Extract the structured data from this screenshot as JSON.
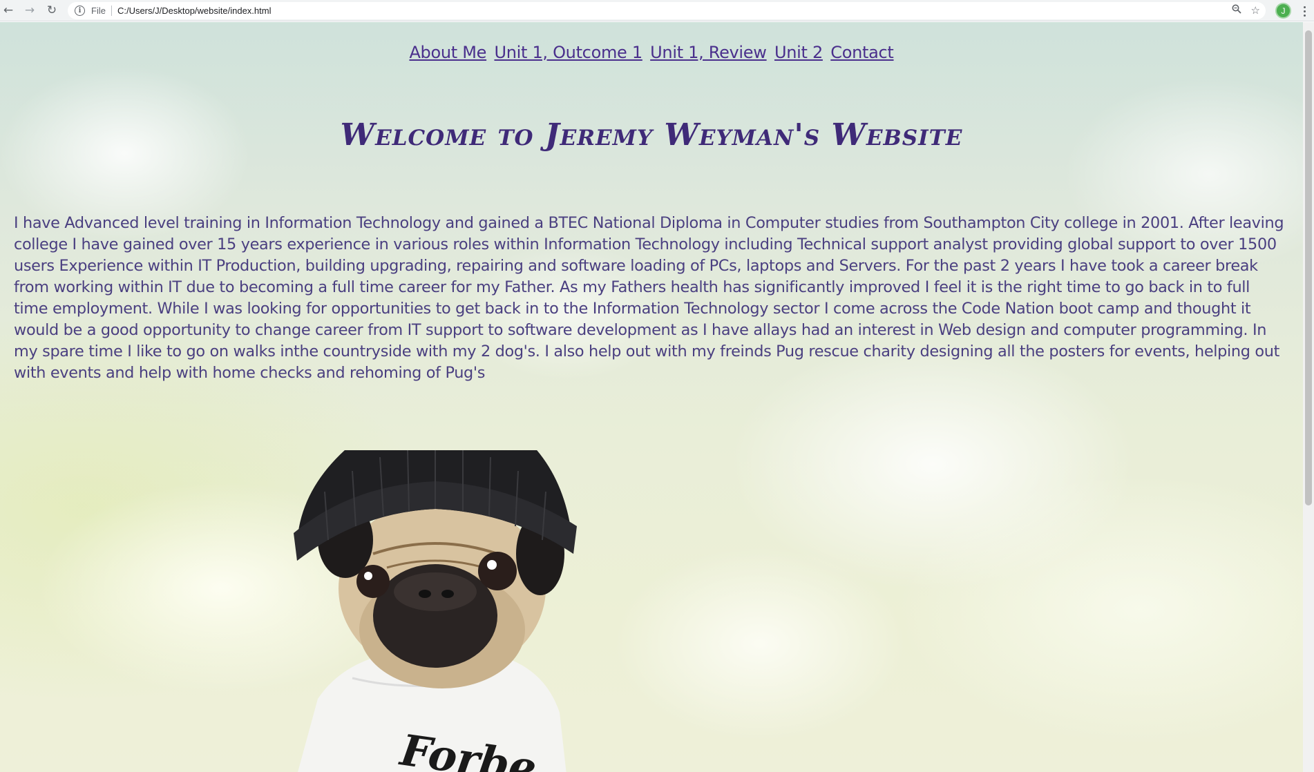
{
  "browser": {
    "scheme_label": "File",
    "url": "C:/Users/J/Desktop/website/index.html",
    "profile_initial": "J",
    "icons": {
      "back": "arrow-left-icon",
      "forward": "arrow-right-icon",
      "reload": "reload-icon",
      "info": "info-icon",
      "zoom": "magnifier-icon",
      "bookmark": "star-icon",
      "menu": "three-dots-icon"
    }
  },
  "nav": {
    "items": [
      {
        "label": "About Me"
      },
      {
        "label": "Unit 1, Outcome 1"
      },
      {
        "label": "Unit 1, Review"
      },
      {
        "label": "Unit 2"
      },
      {
        "label": "Contact"
      }
    ]
  },
  "page": {
    "title": "Welcome to Jeremy Weyman's Website",
    "bio": "I have Advanced level training in Information Technology and gained a BTEC National Diploma in Computer studies from Southampton City college in 2001. After leaving college I have gained over 15 years experience in various roles within Information Technology including Technical support analyst providing global support to over 1500 users Experience within IT Production, building upgrading, repairing and software loading of PCs, laptops and Servers. For the past 2 years I have took a career break from working within IT due to becoming a full time career for my Father. As my Fathers health has significantly improved I feel it is the right time to go back in to full time employment. While I was looking for opportunities to get back in to the Information Technology sector I come across the Code Nation boot camp and thought it would be a good opportunity to change career from IT support to software development as I have allays had an interest in Web design and computer programming. In my spare time I like to go on walks inthe countryside with my 2 dog's. I also help out with my freinds Pug rescue charity designing all the posters for events, helping out with events and help with home checks and rehoming of Pug's",
    "image_shirt_text": "Forbe"
  },
  "colors": {
    "link": "#4a2f8c",
    "title": "#3f2a78",
    "text": "#4a3f80"
  }
}
